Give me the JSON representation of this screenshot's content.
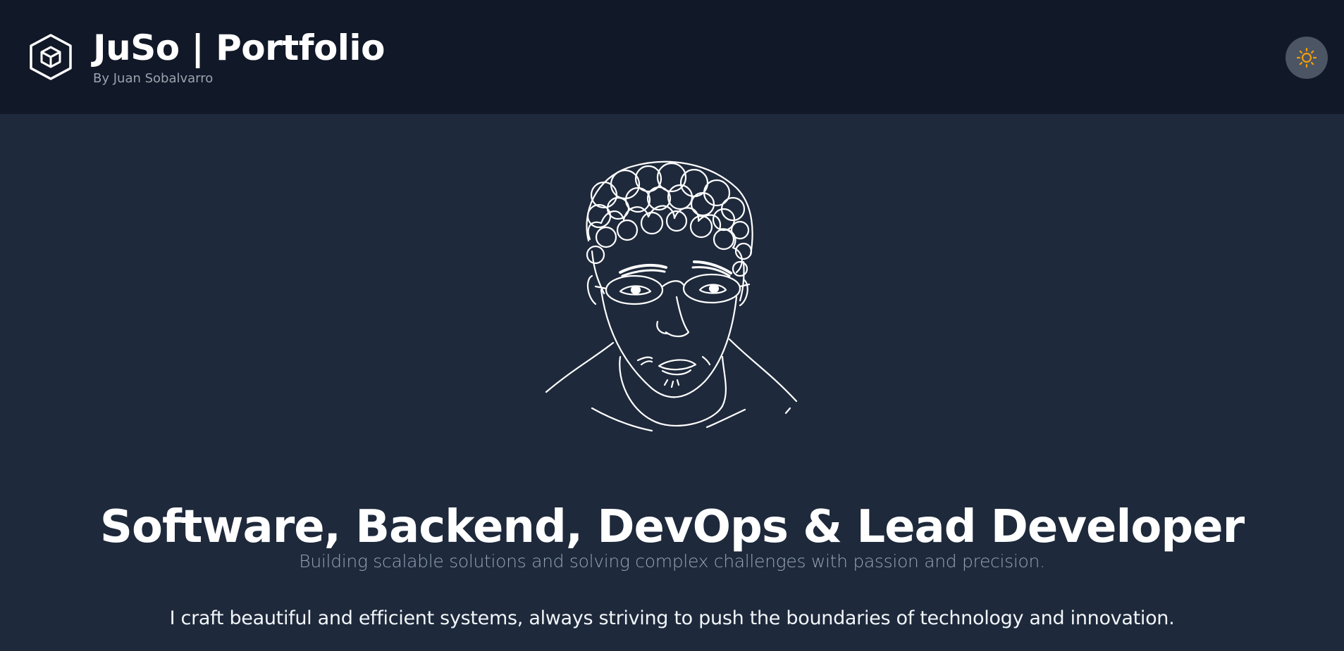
{
  "header": {
    "logo_icon": "cube-hexagon-icon",
    "title": "JuSo | Portfolio",
    "subtitle": "By Juan Sobalvarro",
    "theme_toggle_icon": "sun-icon"
  },
  "hero": {
    "portrait_icon": "line-drawing-portrait",
    "title": "Software, Backend, DevOps & Lead Developer",
    "subtitle": "Building scalable solutions and solving complex challenges with passion and precision.",
    "body": "I craft beautiful and efficient systems, always striving to push the boundaries of technology and innovation."
  },
  "colors": {
    "header_bg": "#111827",
    "page_bg": "#1e293b",
    "toggle_bg": "#4b5563",
    "sun_color": "#f59e0b",
    "text_primary": "#ffffff",
    "text_muted": "#94a3b8"
  }
}
